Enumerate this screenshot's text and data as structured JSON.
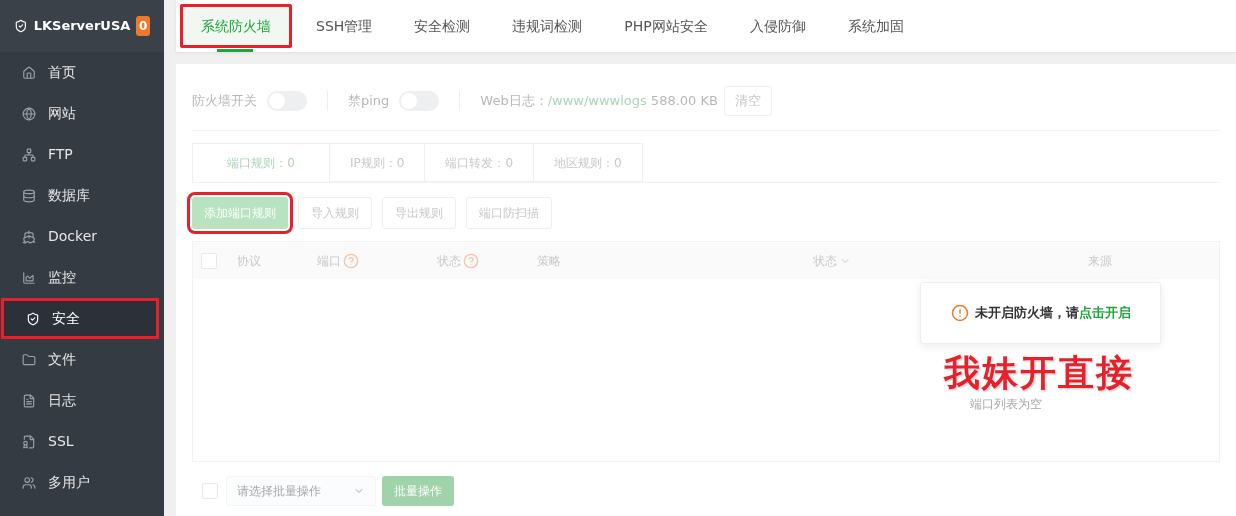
{
  "sidebar": {
    "brand": "LKServerUSA",
    "badge": "0",
    "items": [
      {
        "label": "首页",
        "selected": false,
        "highlighted": false
      },
      {
        "label": "网站",
        "selected": false,
        "highlighted": false
      },
      {
        "label": "FTP",
        "selected": false,
        "highlighted": false
      },
      {
        "label": "数据库",
        "selected": false,
        "highlighted": false
      },
      {
        "label": "Docker",
        "selected": false,
        "highlighted": false
      },
      {
        "label": "监控",
        "selected": false,
        "highlighted": false
      },
      {
        "label": "安全",
        "selected": true,
        "highlighted": true
      },
      {
        "label": "文件",
        "selected": false,
        "highlighted": false
      },
      {
        "label": "日志",
        "selected": false,
        "highlighted": false
      },
      {
        "label": "SSL",
        "selected": false,
        "highlighted": false
      },
      {
        "label": "多用户",
        "selected": false,
        "highlighted": false
      }
    ]
  },
  "tabs": [
    {
      "label": "系统防火墙",
      "selected": true,
      "highlighted": true
    },
    {
      "label": "SSH管理",
      "selected": false,
      "highlighted": false
    },
    {
      "label": "安全检测",
      "selected": false,
      "highlighted": false
    },
    {
      "label": "违规词检测",
      "selected": false,
      "highlighted": false
    },
    {
      "label": "PHP网站安全",
      "selected": false,
      "highlighted": false
    },
    {
      "label": "入侵防御",
      "selected": false,
      "highlighted": false
    },
    {
      "label": "系统加固",
      "selected": false,
      "highlighted": false
    }
  ],
  "toolbar": {
    "firewall_label": "防火墙开关",
    "firewall_on": false,
    "ping_label": "禁ping",
    "ping_on": false,
    "log_label": "Web日志：",
    "log_path": "/www/wwwlogs",
    "log_size": "588.00 KB",
    "clear_button": "清空"
  },
  "subtabs": [
    {
      "label": "端口规则：0",
      "selected": true
    },
    {
      "label": "IP规则：0",
      "selected": false
    },
    {
      "label": "端口转发：0",
      "selected": false
    },
    {
      "label": "地区规则：0",
      "selected": false
    }
  ],
  "buttons": [
    {
      "label": "添加端口规则",
      "kind": "primary",
      "highlighted": true
    },
    {
      "label": "导入规则",
      "kind": "default",
      "highlighted": false
    },
    {
      "label": "导出规则",
      "kind": "default",
      "highlighted": false
    },
    {
      "label": "端口防扫描",
      "kind": "default",
      "highlighted": false
    }
  ],
  "table": {
    "select_all_checked": false,
    "columns": [
      {
        "label": "协议",
        "help": false,
        "sort": false
      },
      {
        "label": "端口",
        "help": true,
        "sort": false
      },
      {
        "label": "状态",
        "help": true,
        "sort": false
      },
      {
        "label": "策略",
        "help": false,
        "sort": false
      },
      {
        "label": "状态",
        "help": false,
        "sort": true
      },
      {
        "label": "来源",
        "help": false,
        "sort": false
      }
    ],
    "empty_text": "端口列表为空"
  },
  "batch": {
    "checked": false,
    "placeholder": "请选择批量操作",
    "button": "批量操作"
  },
  "toast": {
    "text": "未开启防火墙，请",
    "link": "点击开启"
  },
  "annotation": "我妹开直接"
}
